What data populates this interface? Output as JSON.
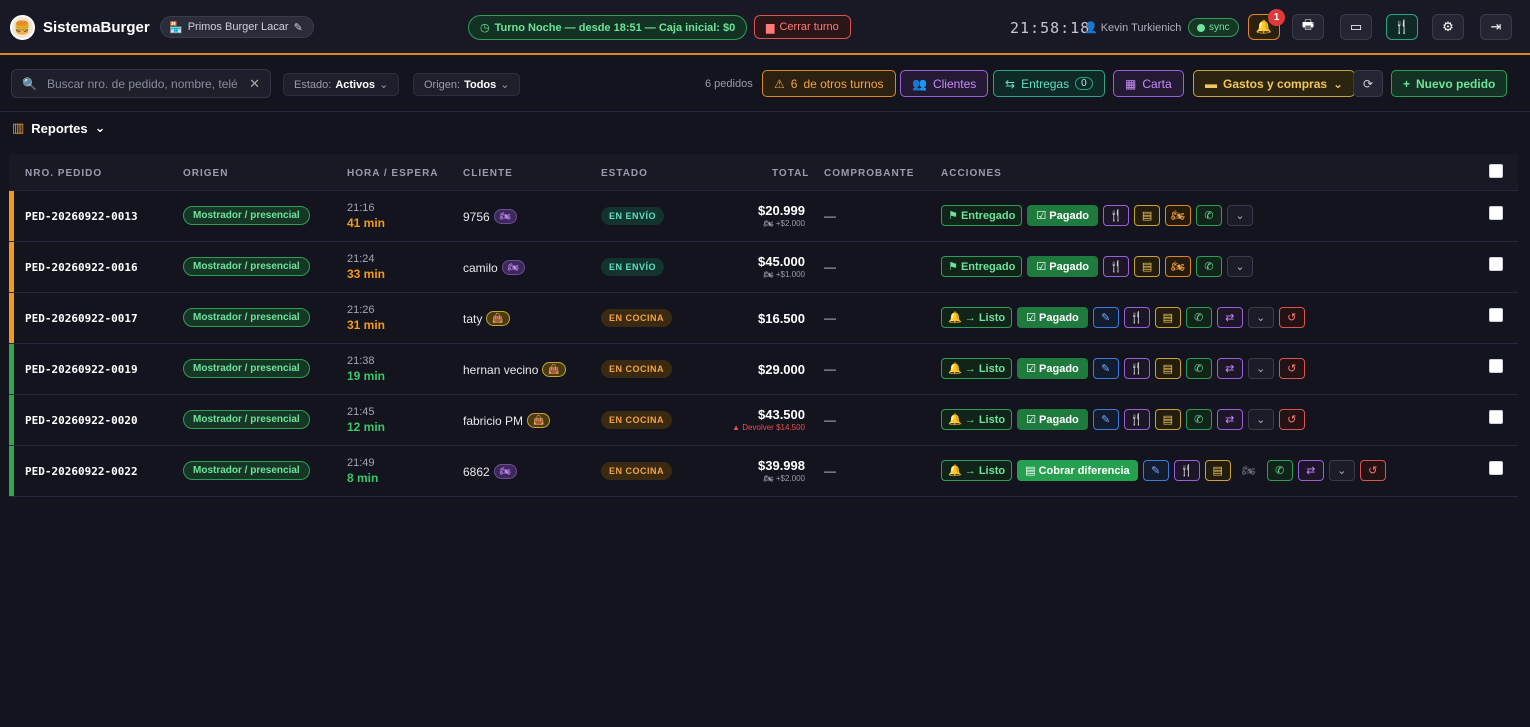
{
  "topbar": {
    "brand": "SistemaBurger",
    "store": "Primos Burger Lacar",
    "turno": "Turno Noche — desde 18:51 — Caja inicial: $0",
    "cerrar": "Cerrar turno",
    "clock": "21:58:18",
    "user": "Kevin Turkienich",
    "sync": "sync",
    "notifications": "1"
  },
  "toolbar": {
    "search_placeholder": "Buscar nro. de pedido, nombre, telé",
    "estado_label": "Estado:",
    "estado_value": "Activos",
    "origen_label": "Origen:",
    "origen_value": "Todos",
    "count": "6 pedidos",
    "otros_turnos_num": "6",
    "otros_turnos": "de otros turnos",
    "clientes": "Clientes",
    "entregas": "Entregas",
    "entregas_count": "0",
    "carta": "Carta",
    "gastos": "Gastos y compras",
    "nuevo": "Nuevo pedido"
  },
  "reportes": "Reportes",
  "columns": {
    "pedido": "NRO. PEDIDO",
    "origen": "ORIGEN",
    "hora": "HORA / ESPERA",
    "cliente": "CLIENTE",
    "estado": "ESTADO",
    "total": "TOTAL",
    "comprobante": "COMPROBANTE",
    "acciones": "ACCIONES"
  },
  "colors": {
    "orange": "#f39a1e",
    "green": "#2ea84f",
    "accent": "#d78a1f"
  },
  "orders": [
    {
      "id": "PED-20260922-0013",
      "origin": "Mostrador / presencial",
      "time": "21:16",
      "wait": "41 min",
      "client": "9756",
      "client_icon": "moto",
      "state": "EN ENVÍO",
      "total": "$20.999",
      "sub": "+$2.000",
      "comp": "—",
      "primary": "Entregado",
      "pay": "Pagado"
    },
    {
      "id": "PED-20260922-0016",
      "origin": "Mostrador / presencial",
      "time": "21:24",
      "wait": "33 min",
      "client": "camilo",
      "client_icon": "moto",
      "state": "EN ENVÍO",
      "total": "$45.000",
      "sub": "+$1.000",
      "comp": "—",
      "primary": "Entregado",
      "pay": "Pagado"
    },
    {
      "id": "PED-20260922-0017",
      "origin": "Mostrador / presencial",
      "time": "21:26",
      "wait": "31 min",
      "client": "taty",
      "client_icon": "bag",
      "state": "EN COCINA",
      "total": "$16.500",
      "sub": "",
      "comp": "—",
      "primary": "→ Listo",
      "pay": "Pagado"
    },
    {
      "id": "PED-20260922-0019",
      "origin": "Mostrador / presencial",
      "time": "21:38",
      "wait": "19 min",
      "client": "hernan vecino",
      "client_icon": "bag",
      "state": "EN COCINA",
      "total": "$29.000",
      "sub": "",
      "comp": "—",
      "primary": "→ Listo",
      "pay": "Pagado"
    },
    {
      "id": "PED-20260922-0020",
      "origin": "Mostrador / presencial",
      "time": "21:45",
      "wait": "12 min",
      "client": "fabricio PM",
      "client_icon": "bag",
      "state": "EN COCINA",
      "total": "$43.500",
      "sub": "Devolver $14.500",
      "comp": "—",
      "primary": "→ Listo",
      "pay": "Pagado"
    },
    {
      "id": "PED-20260922-0022",
      "origin": "Mostrador / presencial",
      "time": "21:49",
      "wait": "8 min",
      "client": "6862",
      "client_icon": "moto",
      "state": "EN COCINA",
      "total": "$39.998",
      "sub": "+$2.000",
      "comp": "—",
      "primary": "→ Listo",
      "pay": "Cobrar diferencia"
    }
  ]
}
